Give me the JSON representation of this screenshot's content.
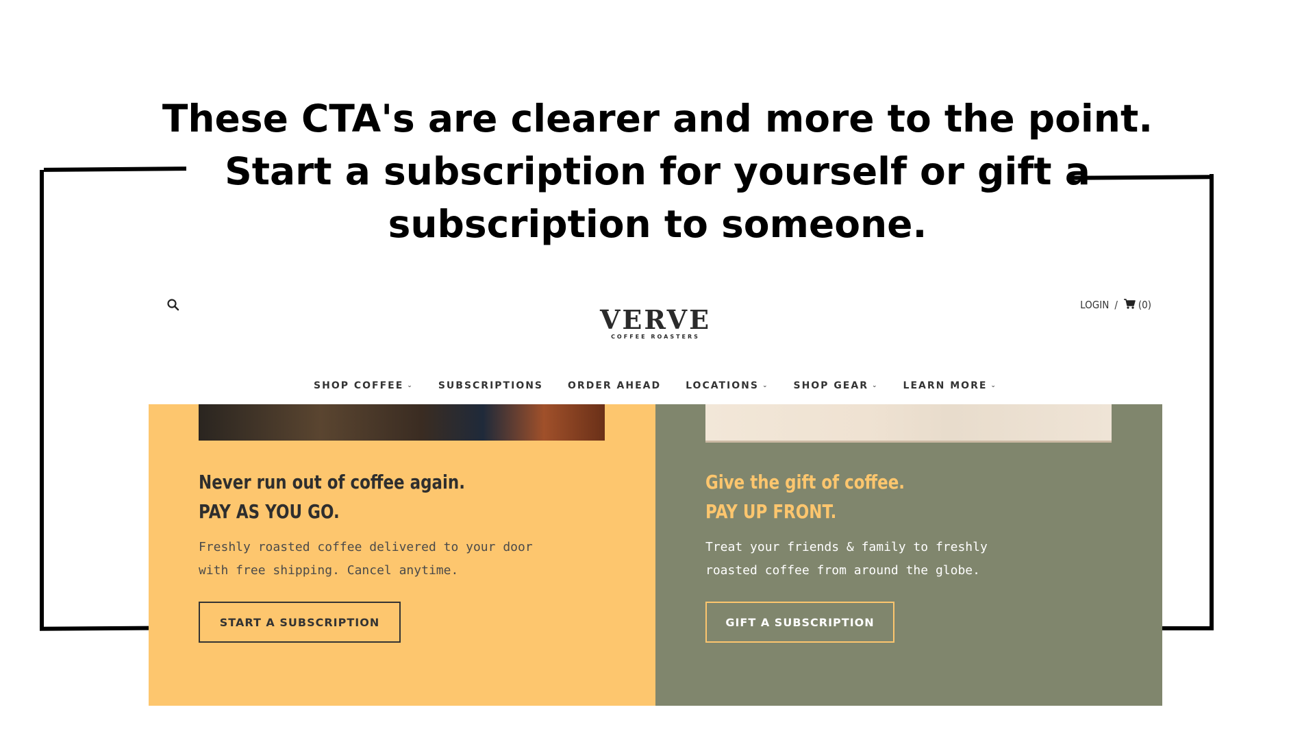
{
  "annotation": {
    "lines": [
      "These CTA's are clearer and more to the point.",
      "Start a  subscription for yourself or gift a",
      "subscription to someone."
    ]
  },
  "header": {
    "search_icon": "search-icon",
    "logo_main": "VERVE",
    "logo_sub": "COFFEE ROASTERS",
    "login_label": "LOGIN",
    "separator": "/",
    "cart_icon": "cart-icon",
    "cart_count": "(0)"
  },
  "nav": {
    "items": [
      {
        "label": "SHOP COFFEE",
        "has_dropdown": true
      },
      {
        "label": "SUBSCRIPTIONS",
        "has_dropdown": false
      },
      {
        "label": "ORDER AHEAD",
        "has_dropdown": false
      },
      {
        "label": "LOCATIONS",
        "has_dropdown": true
      },
      {
        "label": "SHOP GEAR",
        "has_dropdown": true
      },
      {
        "label": "LEARN MORE",
        "has_dropdown": true
      }
    ],
    "chevron": "⌄"
  },
  "panels": {
    "left": {
      "title_line1": "Never run out of coffee again.",
      "title_line2": "PAY AS YOU GO.",
      "desc_line1": "Freshly roasted coffee delivered to your door",
      "desc_line2": "with free shipping. Cancel anytime.",
      "cta_label": "START A SUBSCRIPTION",
      "background": "#fdc66e"
    },
    "right": {
      "title_line1": "Give the gift of coffee.",
      "title_line2": "PAY UP FRONT.",
      "desc_line1": "Treat your friends & family to freshly",
      "desc_line2": "roasted coffee from around the globe.",
      "cta_label": "GIFT A SUBSCRIPTION",
      "background": "#80866d",
      "accent": "#fdc66e"
    }
  }
}
